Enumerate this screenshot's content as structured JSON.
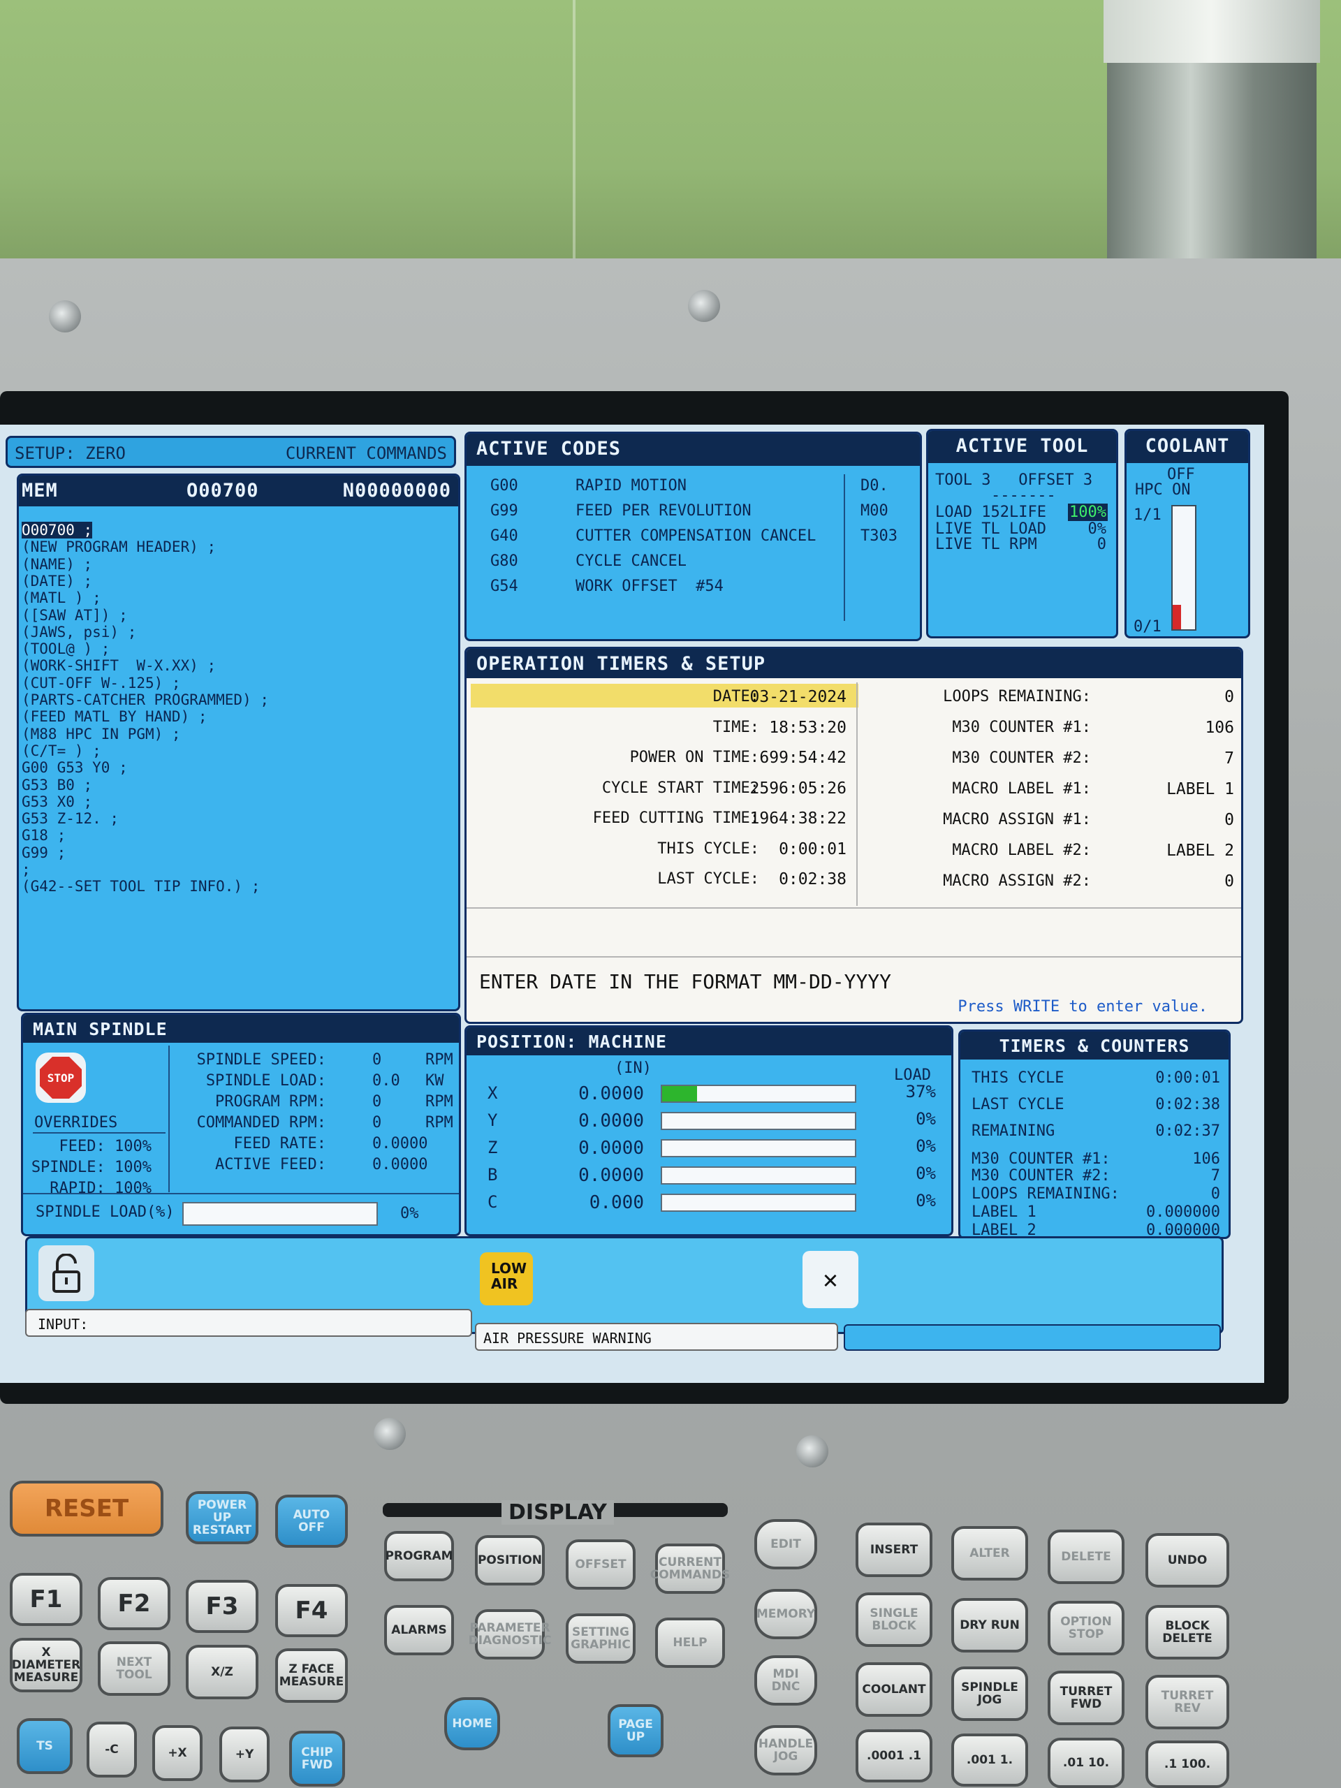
{
  "setup_bar": {
    "left": "SETUP: ZERO",
    "right": "CURRENT COMMANDS"
  },
  "program": {
    "mode": "MEM",
    "program_number": "O00700",
    "sequence_number": "N00000000",
    "lines": [
      "O00700 ;",
      "(NEW PROGRAM HEADER) ;",
      "(NAME) ;",
      "(DATE) ;",
      "(MATL ) ;",
      "([SAW AT]) ;",
      "(JAWS, psi) ;",
      "(TOOL@ ) ;",
      "(WORK-SHIFT  W-X.XX) ;",
      "(CUT-OFF W-.125) ;",
      "(PARTS-CATCHER PROGRAMMED) ;",
      "(FEED MATL BY HAND) ;",
      "(M88 HPC IN PGM) ;",
      "(C/T= ) ;",
      "G00 G53 Y0 ;",
      "G53 B0 ;",
      "G53 X0 ;",
      "G53 Z-12. ;",
      "G18 ;",
      "G99 ;",
      ";",
      "(G42--SET TOOL TIP INFO.) ;"
    ]
  },
  "active_codes": {
    "title": "ACTIVE CODES",
    "codes": [
      {
        "code": "G00",
        "desc": "RAPID MOTION"
      },
      {
        "code": "G99",
        "desc": "FEED PER REVOLUTION"
      },
      {
        "code": "G40",
        "desc": "CUTTER COMPENSATION CANCEL"
      },
      {
        "code": "G80",
        "desc": "CYCLE CANCEL"
      },
      {
        "code": "G54",
        "desc": "WORK OFFSET  #54"
      }
    ],
    "side": [
      "D0.",
      "M00",
      "T303"
    ]
  },
  "active_tool": {
    "title": "ACTIVE TOOL",
    "tool_line": "TOOL 3   OFFSET 3",
    "dashes": "-------",
    "load_line": "LOAD 152LIFE",
    "life_value": "100%",
    "live_load": "LIVE TL LOAD",
    "live_load_value": "0%",
    "live_rpm": "LIVE TL RPM",
    "live_rpm_value": "0"
  },
  "coolant": {
    "title": "COOLANT",
    "state": "OFF",
    "hpc": "HPC ON",
    "top_label": "1/1",
    "bottom_label": "0/1",
    "level_fraction": 0.2
  },
  "timers": {
    "title": "OPERATION TIMERS & SETUP",
    "left": [
      {
        "label": "DATE:",
        "value": "03-21-2024"
      },
      {
        "label": "TIME:",
        "value": "18:53:20"
      },
      {
        "label": "POWER ON TIME:",
        "value": "699:54:42"
      },
      {
        "label": "CYCLE START TIME:",
        "value": "2596:05:26"
      },
      {
        "label": "FEED CUTTING TIME:",
        "value": "1964:38:22"
      },
      {
        "label": "THIS CYCLE:",
        "value": "0:00:01"
      },
      {
        "label": "LAST CYCLE:",
        "value": "0:02:38"
      }
    ],
    "right": [
      {
        "label": "LOOPS REMAINING:",
        "value": "0"
      },
      {
        "label": "M30 COUNTER #1:",
        "value": "106"
      },
      {
        "label": "M30 COUNTER #2:",
        "value": "7"
      },
      {
        "label": "MACRO LABEL #1:",
        "value": "LABEL 1"
      },
      {
        "label": "MACRO ASSIGN #1:",
        "value": "0"
      },
      {
        "label": "MACRO LABEL #2:",
        "value": "LABEL 2"
      },
      {
        "label": "MACRO ASSIGN #2:",
        "value": "0"
      }
    ],
    "prompt": "ENTER DATE IN THE FORMAT MM-DD-YYYY",
    "hint": "Press WRITE to enter value."
  },
  "spindle": {
    "title": "MAIN SPINDLE",
    "stop": "STOP",
    "overrides_title": "OVERRIDES",
    "overrides": [
      "FEED: 100%",
      "SPINDLE: 100%",
      "RAPID: 100%"
    ],
    "stats": [
      {
        "label": "SPINDLE SPEED:",
        "value": "0",
        "unit": "RPM"
      },
      {
        "label": "SPINDLE LOAD:",
        "value": "0.0",
        "unit": "KW"
      },
      {
        "label": "PROGRAM RPM:",
        "value": "0",
        "unit": "RPM"
      },
      {
        "label": "COMMANDED RPM:",
        "value": "0",
        "unit": "RPM"
      },
      {
        "label": "FEED RATE:",
        "value": "0.0000",
        "unit": ""
      },
      {
        "label": "ACTIVE FEED:",
        "value": "0.0000",
        "unit": ""
      }
    ],
    "load_label": "SPINDLE LOAD(%)",
    "load_value": "0%",
    "load_fraction": 0
  },
  "position": {
    "title": "POSITION:  MACHINE",
    "units": "(IN)",
    "load_header": "LOAD",
    "axes": [
      {
        "axis": "X",
        "value": "0.0000",
        "load": "37%",
        "load_fraction": 0.18
      },
      {
        "axis": "Y",
        "value": "0.0000",
        "load": "0%",
        "load_fraction": 0
      },
      {
        "axis": "Z",
        "value": "0.0000",
        "load": "0%",
        "load_fraction": 0
      },
      {
        "axis": "B",
        "value": "0.0000",
        "load": "0%",
        "load_fraction": 0
      },
      {
        "axis": "C",
        "value": "0.000",
        "load": "0%",
        "load_fraction": 0
      }
    ]
  },
  "counters": {
    "title": "TIMERS & COUNTERS",
    "rows": [
      {
        "label": "THIS CYCLE",
        "value": "0:00:01"
      },
      {
        "label": "LAST CYCLE",
        "value": "0:02:38"
      },
      {
        "label": "REMAINING",
        "value": "0:02:37"
      },
      {
        "label": "M30 COUNTER #1:",
        "value": "106"
      },
      {
        "label": "M30 COUNTER #2:",
        "value": "7"
      },
      {
        "label": "LOOPS REMAINING:",
        "value": "0"
      },
      {
        "label": "LABEL 1",
        "value": "0.000000"
      },
      {
        "label": "LABEL 2",
        "value": "0.000000"
      }
    ]
  },
  "status": {
    "low_air_1": "LOW",
    "low_air_2": "AIR",
    "input_label": "INPUT:",
    "message": "AIR PRESSURE WARNING"
  },
  "keyboard": {
    "display_label": "DISPLAY",
    "keys": [
      "RESET",
      "POWER UP RESTART",
      "AUTO OFF",
      "F1",
      "F2",
      "F3",
      "F4",
      "X DIAMETER MEASURE",
      "NEXT TOOL",
      "X/Z",
      "Z FACE MEASURE",
      "TS",
      "-C",
      "+X",
      "+Y",
      "CHIP FWD",
      "PROGRAM",
      "POSITION",
      "OFFSET",
      "CURRENT COMMANDS",
      "ALARMS",
      "PARAMETER DIAGNOSTIC",
      "SETTING GRAPHIC",
      "HELP",
      "HOME",
      "PAGE UP",
      "EDIT",
      "MEMORY",
      "MDI DNC",
      "HANDLE JOG",
      "INSERT",
      "ALTER",
      "DELETE",
      "UNDO",
      "SINGLE BLOCK",
      "DRY RUN",
      "OPTION STOP",
      "BLOCK DELETE",
      "COOLANT",
      "SPINDLE JOG",
      "TURRET FWD",
      "TURRET REV",
      ".0001 .1",
      ".001 1.",
      ".01 10.",
      ".1 100."
    ]
  }
}
